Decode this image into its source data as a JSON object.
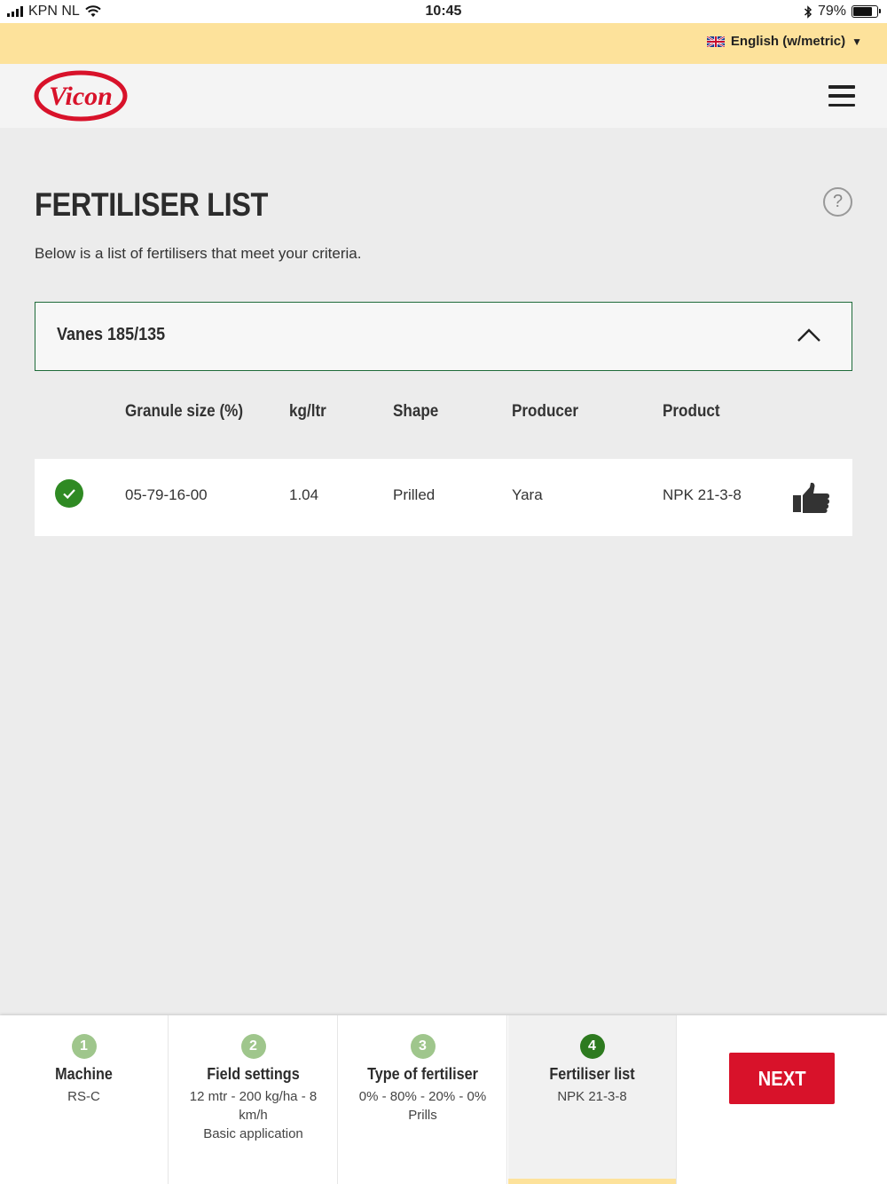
{
  "status_bar": {
    "carrier": "KPN NL",
    "time": "10:45",
    "battery_percent": "79%",
    "battery_level": 0.79,
    "icons": [
      "signal-icon",
      "wifi-icon",
      "bluetooth-icon",
      "battery-icon"
    ]
  },
  "language_bar": {
    "selected_language": "English (w/metric)",
    "icons": [
      "uk-flag-icon",
      "caret-down-icon"
    ],
    "background_color": "#fde29b"
  },
  "header": {
    "logo_text": "Vicon",
    "brand_color": "#d8122a",
    "icons": [
      "hamburger-menu-icon"
    ]
  },
  "main": {
    "title": "FERTILISER LIST",
    "subtitle": "Below is a list of fertilisers that meet your criteria.",
    "help_icon": "?",
    "panel": {
      "label": "Vanes 185/135",
      "expanded": true,
      "icon": "chevron-up-icon",
      "border_color": "#1f6b3a"
    },
    "table": {
      "columns": [
        "Granule size (%)",
        "kg/ltr",
        "Shape",
        "Producer",
        "Product"
      ],
      "rows": [
        {
          "status_icon": "check-circle-icon",
          "granule_size": "05-79-16-00",
          "kg_ltr": "1.04",
          "shape": "Prilled",
          "producer": "Yara",
          "product": "NPK 21-3-8",
          "action_icon": "thumbs-up-icon"
        }
      ]
    }
  },
  "stepper": {
    "steps": [
      {
        "number": "1",
        "title": "Machine",
        "lines": [
          "RS-C"
        ],
        "active": false
      },
      {
        "number": "2",
        "title": "Field settings",
        "lines": [
          "12 mtr - 200 kg/ha - 8 km/h",
          "Basic application"
        ],
        "active": false
      },
      {
        "number": "3",
        "title": "Type of fertiliser",
        "lines": [
          "0% - 80% - 20% - 0%",
          "Prills"
        ],
        "active": false
      },
      {
        "number": "4",
        "title": "Fertiliser list",
        "lines": [
          "NPK 21-3-8"
        ],
        "active": true
      }
    ],
    "next_label": "NEXT",
    "step_done_color": "#9fc68c",
    "step_active_color": "#2d7a1f"
  }
}
